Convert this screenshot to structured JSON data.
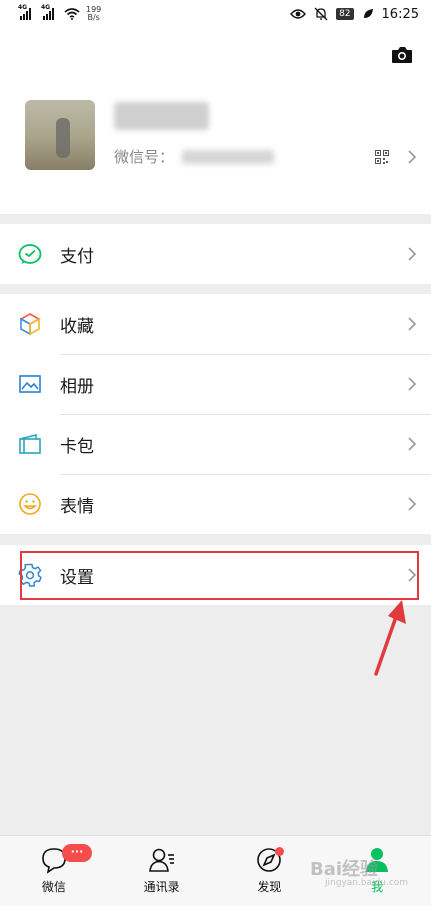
{
  "status_bar": {
    "network_1": "4G",
    "network_2": "4G",
    "speed_value": "199",
    "speed_unit": "B/s",
    "battery": "82",
    "time": "16:25"
  },
  "profile": {
    "wechat_id_label": "微信号："
  },
  "menu": {
    "pay": "支付",
    "favorites": "收藏",
    "album": "相册",
    "cards": "卡包",
    "stickers": "表情",
    "settings": "设置"
  },
  "tabs": {
    "chats": "微信",
    "contacts": "通讯录",
    "discover": "发现",
    "me": "我",
    "chats_badge": "···"
  },
  "watermark": {
    "text": "Bai经验",
    "sub": "jingyan.baidu.com"
  },
  "colors": {
    "accent": "#07c160",
    "highlight": "#e0393e",
    "badge": "#f74c4c"
  }
}
